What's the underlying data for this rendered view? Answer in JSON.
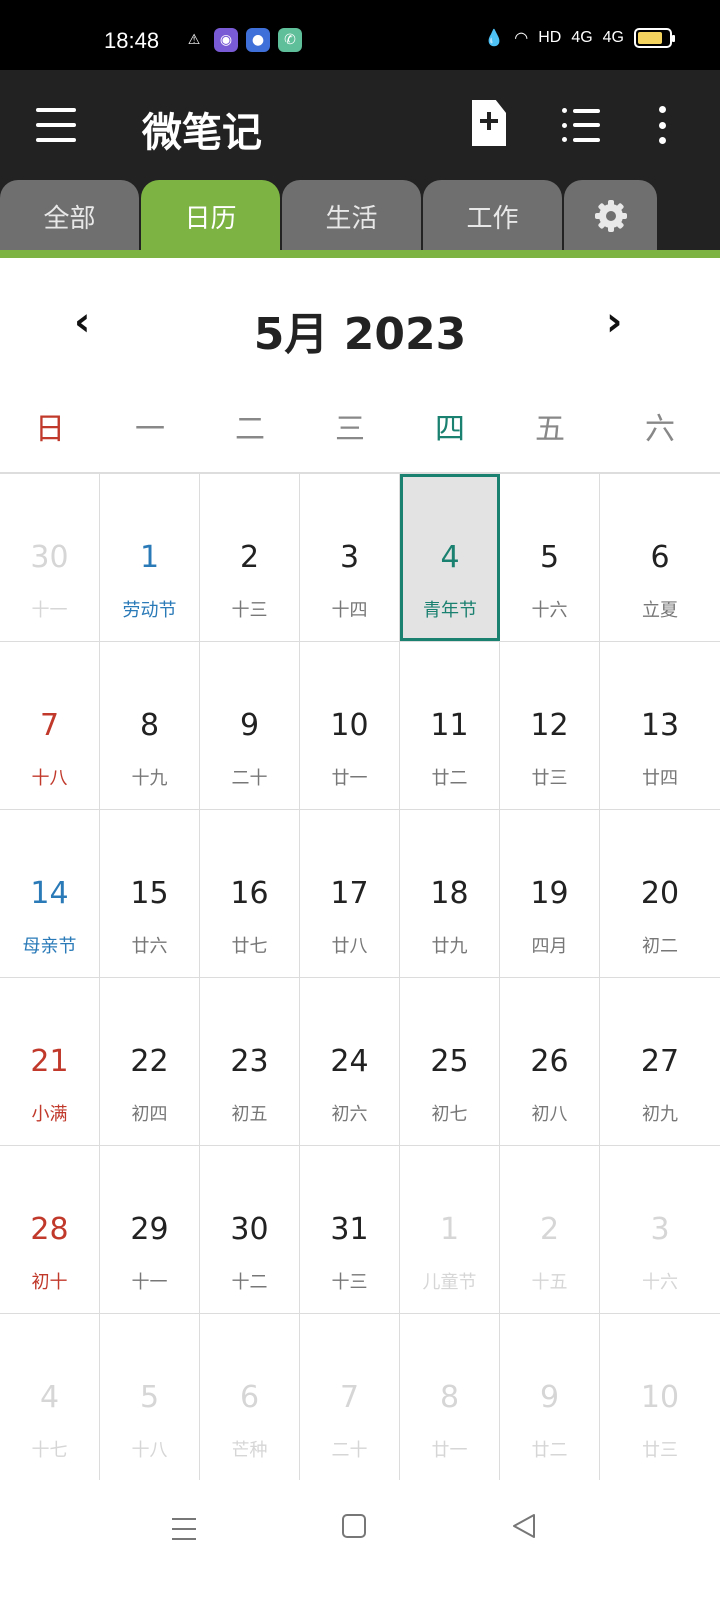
{
  "status_bar": {
    "time": "18:48",
    "network_label": "HD",
    "signal_1": "4G",
    "signal_2": "4G",
    "battery_level": 0.8
  },
  "app_bar": {
    "title": "微笔记"
  },
  "tabs": [
    {
      "label": "全部",
      "active": false
    },
    {
      "label": "日历",
      "active": true
    },
    {
      "label": "生活",
      "active": false
    },
    {
      "label": "工作",
      "active": false
    },
    {
      "label": "",
      "icon": "gear-icon",
      "active": false
    }
  ],
  "calendar": {
    "prev_label": "‹",
    "next_label": "›",
    "month_title": "5月 2023",
    "weekdays": [
      "日",
      "一",
      "二",
      "三",
      "四",
      "五",
      "六"
    ],
    "weeks": [
      [
        {
          "day": "30",
          "lunar": "十一",
          "state": "other"
        },
        {
          "day": "1",
          "lunar": "劳动节",
          "state": "fest"
        },
        {
          "day": "2",
          "lunar": "十三",
          "state": ""
        },
        {
          "day": "3",
          "lunar": "十四",
          "state": ""
        },
        {
          "day": "4",
          "lunar": "青年节",
          "state": "today"
        },
        {
          "day": "5",
          "lunar": "十六",
          "state": ""
        },
        {
          "day": "6",
          "lunar": "立夏",
          "state": ""
        }
      ],
      [
        {
          "day": "7",
          "lunar": "十八",
          "state": "sun"
        },
        {
          "day": "8",
          "lunar": "十九",
          "state": ""
        },
        {
          "day": "9",
          "lunar": "二十",
          "state": ""
        },
        {
          "day": "10",
          "lunar": "廿一",
          "state": ""
        },
        {
          "day": "11",
          "lunar": "廿二",
          "state": ""
        },
        {
          "day": "12",
          "lunar": "廿三",
          "state": ""
        },
        {
          "day": "13",
          "lunar": "廿四",
          "state": ""
        }
      ],
      [
        {
          "day": "14",
          "lunar": "母亲节",
          "state": "fest"
        },
        {
          "day": "15",
          "lunar": "廿六",
          "state": ""
        },
        {
          "day": "16",
          "lunar": "廿七",
          "state": ""
        },
        {
          "day": "17",
          "lunar": "廿八",
          "state": ""
        },
        {
          "day": "18",
          "lunar": "廿九",
          "state": ""
        },
        {
          "day": "19",
          "lunar": "四月",
          "state": ""
        },
        {
          "day": "20",
          "lunar": "初二",
          "state": ""
        }
      ],
      [
        {
          "day": "21",
          "lunar": "小满",
          "state": "sun"
        },
        {
          "day": "22",
          "lunar": "初四",
          "state": ""
        },
        {
          "day": "23",
          "lunar": "初五",
          "state": ""
        },
        {
          "day": "24",
          "lunar": "初六",
          "state": ""
        },
        {
          "day": "25",
          "lunar": "初七",
          "state": ""
        },
        {
          "day": "26",
          "lunar": "初八",
          "state": ""
        },
        {
          "day": "27",
          "lunar": "初九",
          "state": ""
        }
      ],
      [
        {
          "day": "28",
          "lunar": "初十",
          "state": "sun"
        },
        {
          "day": "29",
          "lunar": "十一",
          "state": ""
        },
        {
          "day": "30",
          "lunar": "十二",
          "state": ""
        },
        {
          "day": "31",
          "lunar": "十三",
          "state": ""
        },
        {
          "day": "1",
          "lunar": "儿童节",
          "state": "other"
        },
        {
          "day": "2",
          "lunar": "十五",
          "state": "other"
        },
        {
          "day": "3",
          "lunar": "十六",
          "state": "other"
        }
      ],
      [
        {
          "day": "4",
          "lunar": "十七",
          "state": "other"
        },
        {
          "day": "5",
          "lunar": "十八",
          "state": "other"
        },
        {
          "day": "6",
          "lunar": "芒种",
          "state": "other"
        },
        {
          "day": "7",
          "lunar": "二十",
          "state": "other"
        },
        {
          "day": "8",
          "lunar": "廿一",
          "state": "other"
        },
        {
          "day": "9",
          "lunar": "廿二",
          "state": "other"
        },
        {
          "day": "10",
          "lunar": "廿三",
          "state": "other"
        }
      ]
    ]
  },
  "colors": {
    "accent": "#7cb342",
    "today": "#1a8070",
    "sunday": "#c0392b",
    "festival": "#2a7ab8"
  }
}
